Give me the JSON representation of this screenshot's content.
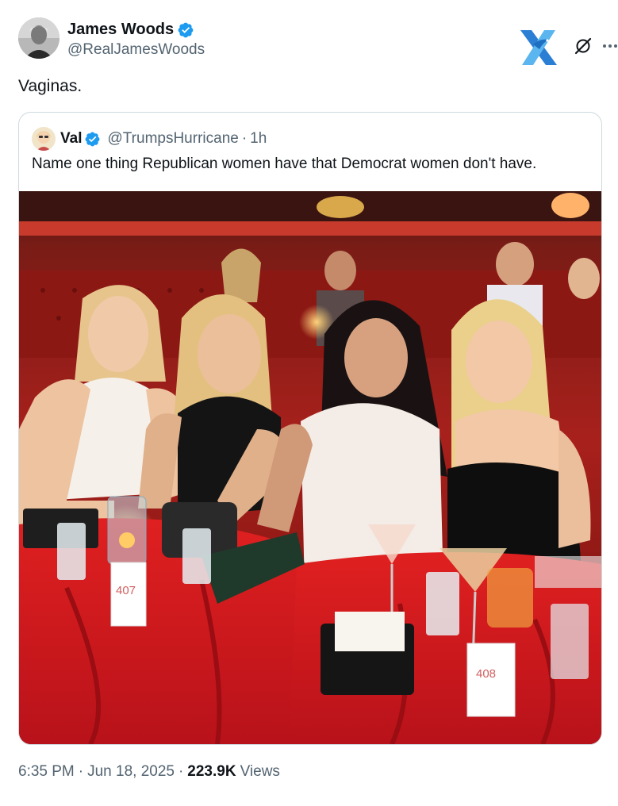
{
  "author": {
    "name": "James Woods",
    "handle": "@RealJamesWoods",
    "verified": true
  },
  "tweet": {
    "text": "Vaginas."
  },
  "quoted_tweet": {
    "name": "Val",
    "handle": "@TrumpsHurricane",
    "time": "1h",
    "text": "Name one thing Republican women have that Democrat women don't have.",
    "table_cards": [
      "407",
      "408"
    ]
  },
  "meta": {
    "time": "6:35 PM",
    "date": "Jun 18, 2025",
    "views_count": "223.9K",
    "views_label": "Views"
  },
  "icons": {
    "verified": "verified-badge-icon",
    "grok": "grok-icon",
    "more": "more-icon",
    "logo": "x-bird-logo"
  },
  "colors": {
    "verified_blue": "#1d9bf0",
    "text_primary": "#0f1419",
    "text_secondary": "#536471",
    "border": "#cfd9de",
    "photo_red": "#c8121a"
  }
}
